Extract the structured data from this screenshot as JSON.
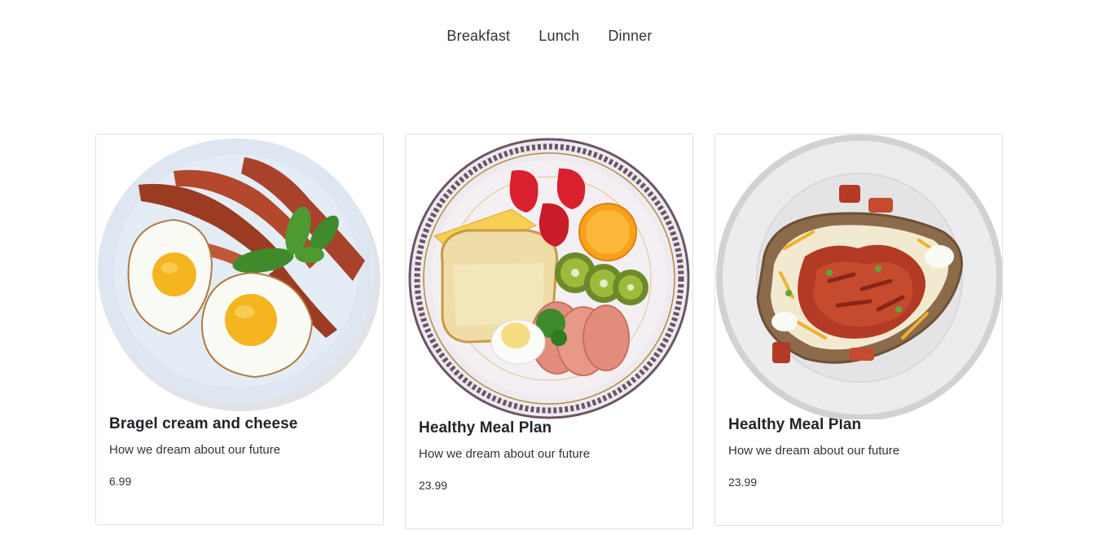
{
  "nav": {
    "items": [
      {
        "label": "Breakfast"
      },
      {
        "label": "Lunch"
      },
      {
        "label": "Dinner"
      }
    ]
  },
  "cards": [
    {
      "title": "Bragel cream and cheese",
      "description": "How we dream about our future",
      "price": "6.99",
      "image": "fried-eggs-bacon-plate"
    },
    {
      "title": "Healthy Meal Plan",
      "description": "How we dream about our future",
      "price": "23.99",
      "image": "toast-fruit-ham-plate"
    },
    {
      "title": "Healthy Meal Plan",
      "description": "How we dream about our future",
      "price": "23.99",
      "image": "loaded-baked-potato-plate"
    }
  ]
}
